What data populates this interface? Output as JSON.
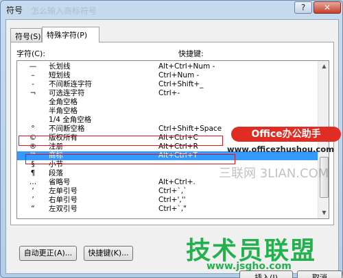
{
  "window": {
    "title": "符号",
    "title_ghost": "怎么输入商标符号"
  },
  "titlebar": {
    "help_label": "?",
    "close_label": "✕"
  },
  "tabs": [
    {
      "label": "符号(S)"
    },
    {
      "label": "特殊字符(P)"
    }
  ],
  "headers": {
    "char": "字符(C):",
    "shortcut": "快捷键:"
  },
  "rows": [
    {
      "sym": "—",
      "name": "长划线",
      "shortcut": "Alt+Ctrl+Num -"
    },
    {
      "sym": "–",
      "name": "短划线",
      "shortcut": "Ctrl+Num -"
    },
    {
      "sym": "-",
      "name": "不间断连字符",
      "shortcut": "Ctrl+Shift+_"
    },
    {
      "sym": "¬",
      "name": "可选连字符",
      "shortcut": "Ctrl+-"
    },
    {
      "sym": "",
      "name": "全角空格",
      "shortcut": ""
    },
    {
      "sym": "",
      "name": "半角空格",
      "shortcut": ""
    },
    {
      "sym": "",
      "name": "1/4 全角空格",
      "shortcut": ""
    },
    {
      "sym": "°",
      "name": "不间断空格",
      "shortcut": "Ctrl+Shift+Space"
    },
    {
      "sym": "©",
      "name": "版权所有",
      "shortcut": "Alt+Ctrl+C"
    },
    {
      "sym": "®",
      "name": "注册",
      "shortcut": "Alt+Ctrl+R"
    },
    {
      "sym": "™",
      "name": "商标",
      "shortcut": "Alt+Ctrl+T"
    },
    {
      "sym": "§",
      "name": "小节",
      "shortcut": ""
    },
    {
      "sym": "¶",
      "name": "段落",
      "shortcut": ""
    },
    {
      "sym": "…",
      "name": "省略号",
      "shortcut": "Alt+Ctrl+."
    },
    {
      "sym": "‘",
      "name": "左单引号",
      "shortcut": "Ctrl+`,`"
    },
    {
      "sym": "’",
      "name": "右单引号",
      "shortcut": "Ctrl+',''"
    },
    {
      "sym": "“",
      "name": "左双引号",
      "shortcut": "Ctrl+`,\""
    }
  ],
  "buttons": {
    "autocorrect": "自动更正(A)...",
    "shortcut_key": "快捷键(K)...",
    "insert": "插入(I)",
    "cancel": "取消"
  },
  "watermarks": {
    "badge": "Office办公助手",
    "url": "www.officezhushou.com",
    "site": "三联网 3LIAN.COM",
    "big": "技术员联盟",
    "big_url": "www.jsgho.com"
  },
  "colors": {
    "selection": "#3399ff",
    "highlight_box": "#e0101c",
    "badge_bg": "#e02d24",
    "watermark_green": "#23b14d"
  },
  "icons": {
    "scroll_up": "chevron-up-icon",
    "scroll_down": "chevron-down-icon"
  }
}
